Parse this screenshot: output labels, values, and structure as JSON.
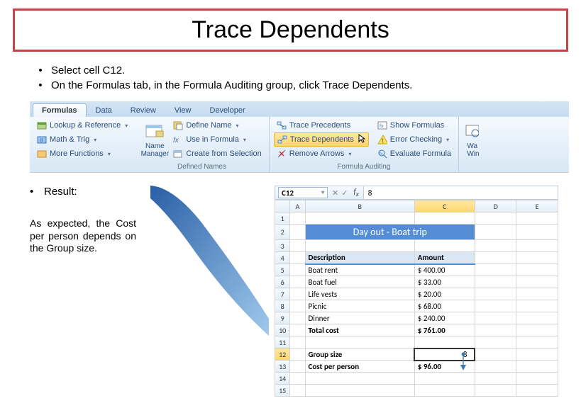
{
  "title": "Trace Dependents",
  "bullets": [
    "Select cell C12.",
    "On the Formulas tab, in the Formula Auditing group, click Trace Dependents."
  ],
  "result_label": "Result:",
  "result_note": "As expected, the Cost per person depends on the Group size.",
  "ribbon": {
    "tabs": [
      "Formulas",
      "Data",
      "Review",
      "View",
      "Developer"
    ],
    "active_tab": "Formulas",
    "library": {
      "lookup": "Lookup & Reference",
      "math": "Math & Trig",
      "more": "More Functions"
    },
    "names": {
      "manager": "Name Manager",
      "define": "Define Name",
      "use": "Use in Formula",
      "create": "Create from Selection",
      "group_label": "Defined Names"
    },
    "audit": {
      "precedents": "Trace Precedents",
      "dependents": "Trace Dependents",
      "remove": "Remove Arrows",
      "show": "Show Formulas",
      "error": "Error Checking",
      "eval": "Evaluate Formula",
      "group_label": "Formula Auditing"
    },
    "watch": {
      "label": "Watch Window",
      "short1": "Wa",
      "short2": "Win"
    }
  },
  "sheet": {
    "cell_ref": "C12",
    "formula_value": "8",
    "cols": [
      "A",
      "B",
      "C",
      "D",
      "E"
    ],
    "title": "Day out - Boat trip",
    "headers": {
      "desc": "Description",
      "amt": "Amount"
    },
    "rows": [
      {
        "label": "Boat rent",
        "amount": "$    400.00"
      },
      {
        "label": "Boat fuel",
        "amount": "$      33.00"
      },
      {
        "label": "Life vests",
        "amount": "$      20.00"
      },
      {
        "label": "Picnic",
        "amount": "$      68.00"
      },
      {
        "label": "Dinner",
        "amount": "$    240.00"
      }
    ],
    "total": {
      "label": "Total cost",
      "amount": "$    761.00"
    },
    "group": {
      "label": "Group size",
      "value": "8"
    },
    "cost": {
      "label": "Cost per person",
      "amount": "$      96.00"
    }
  }
}
